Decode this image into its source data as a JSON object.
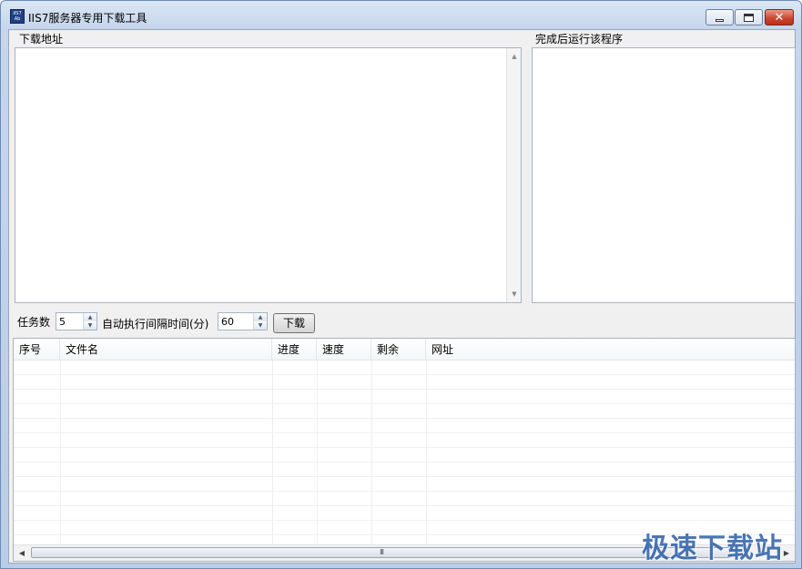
{
  "window": {
    "title": "IIS7服务器专用下载工具",
    "icon": "iis7-app-icon",
    "icon_text": "IIS7 Ab",
    "controls": {
      "minimize": "minimize-icon",
      "maximize": "maximize-icon",
      "close": "close-icon"
    }
  },
  "download_panel": {
    "label": "下载地址",
    "content": ""
  },
  "run_panel": {
    "label": "完成后运行该程序",
    "content": ""
  },
  "toolbar": {
    "task_count_label": "任务数",
    "task_count_value": "5",
    "interval_label": "自动执行间隔时间(分)",
    "interval_value": "60",
    "download_button": "下载"
  },
  "table": {
    "columns": [
      "序号",
      "文件名",
      "进度",
      "速度",
      "剩余",
      "网址"
    ],
    "rows": [],
    "hscroll_thumb": "III"
  },
  "watermark": "极速下载站",
  "colors": {
    "titlebar_top": "#dbe6f4",
    "titlebar_bottom": "#b9cde6",
    "close_button": "#c8432c",
    "watermark": "#2b5fa8"
  }
}
